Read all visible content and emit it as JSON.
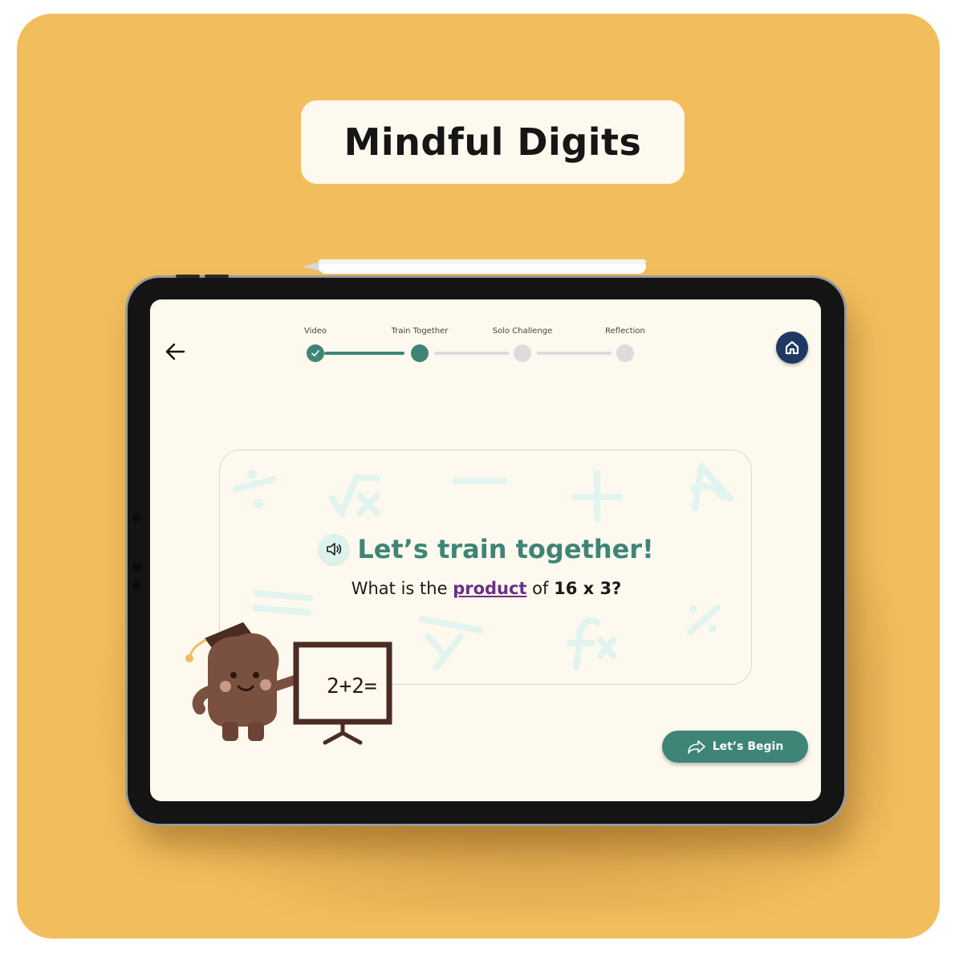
{
  "app": {
    "title": "Mindful Digits"
  },
  "progress": {
    "steps": [
      {
        "label": "Video",
        "state": "done"
      },
      {
        "label": "Train Together",
        "state": "current"
      },
      {
        "label": "Solo Challenge",
        "state": "todo"
      },
      {
        "label": "Reflection",
        "state": "todo"
      }
    ]
  },
  "card": {
    "heading": "Let’s train together!",
    "question_prefix": "What is the ",
    "question_keyword": "product",
    "question_mid": " of ",
    "question_expression": "16 x 3?"
  },
  "mascot": {
    "board_text": "2+2="
  },
  "actions": {
    "begin_label": "Let’s Begin"
  },
  "colors": {
    "background": "#F2BD5C",
    "screen": "#FDF9EE",
    "accent": "#3E8577",
    "home": "#1F3763",
    "keyword": "#6B2F86",
    "inactive": "#DCDCDC"
  },
  "icons": {
    "back": "arrow-left-icon",
    "home": "home-icon",
    "speaker": "speaker-icon",
    "check": "check-icon",
    "begin": "share-arrow-icon"
  }
}
